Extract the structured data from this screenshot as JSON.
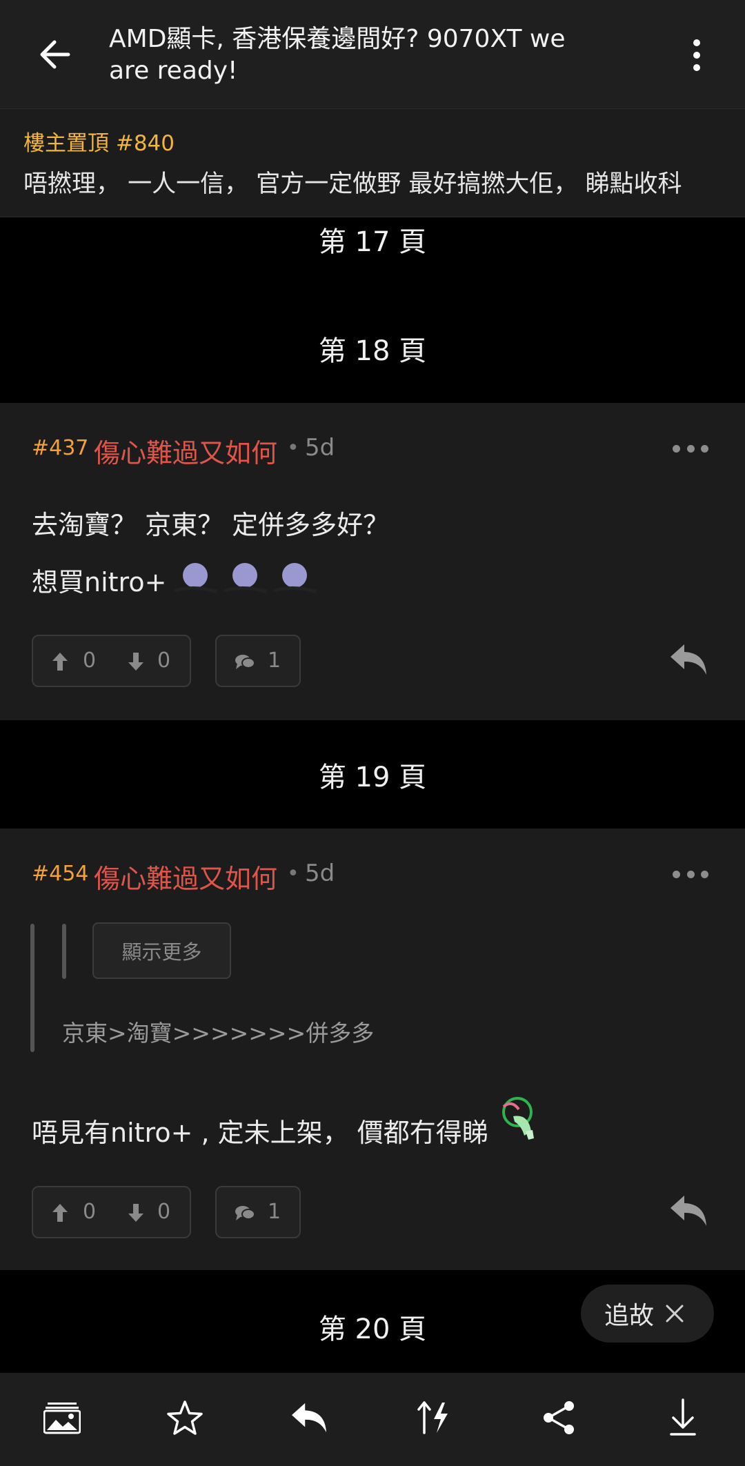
{
  "header": {
    "title": "AMD顯卡, 香港保養邊間好? 9070XT we are ready!",
    "back_icon": "arrow-left-icon",
    "menu_icon": "more-vertical-icon"
  },
  "pinned": {
    "label": "樓主置頂 #840",
    "text": "唔撚理， 一人一信， 官方一定做野 最好搞撚大佢， 睇點收科"
  },
  "pages": {
    "p17": "第 17 頁",
    "p18": "第 18 頁",
    "p19": "第 19 頁",
    "p20": "第 20 頁"
  },
  "posts": [
    {
      "number": "#437",
      "user": "傷心難過又如何",
      "separator": "•",
      "time": "5d",
      "lines": [
        "去淘寶？ 京東？ 定併多多好？",
        "想買nitro+"
      ],
      "upvotes": "0",
      "downvotes": "0",
      "comments": "1"
    },
    {
      "number": "#454",
      "user": "傷心難過又如何",
      "separator": "•",
      "time": "5d",
      "quote_show_more": "顯示更多",
      "quote_text": "京東>淘寶>>>>>>>併多多",
      "lines": [
        "唔見有nitro+ , 定未上架， 價都冇得睇"
      ],
      "upvotes": "0",
      "downvotes": "0",
      "comments": "1"
    }
  ],
  "follow": {
    "label": "追故",
    "close_icon": "close-icon"
  },
  "bottom_bar": {
    "icons": [
      "gallery-icon",
      "star-icon",
      "reply-icon",
      "sort-icon",
      "share-icon",
      "download-icon"
    ]
  },
  "colors": {
    "accent_orange": "#f3a23a",
    "username_red": "#e0554a",
    "pinned_yellow": "#f3b53a",
    "background": "#000000",
    "card": "#1c1c1c"
  }
}
